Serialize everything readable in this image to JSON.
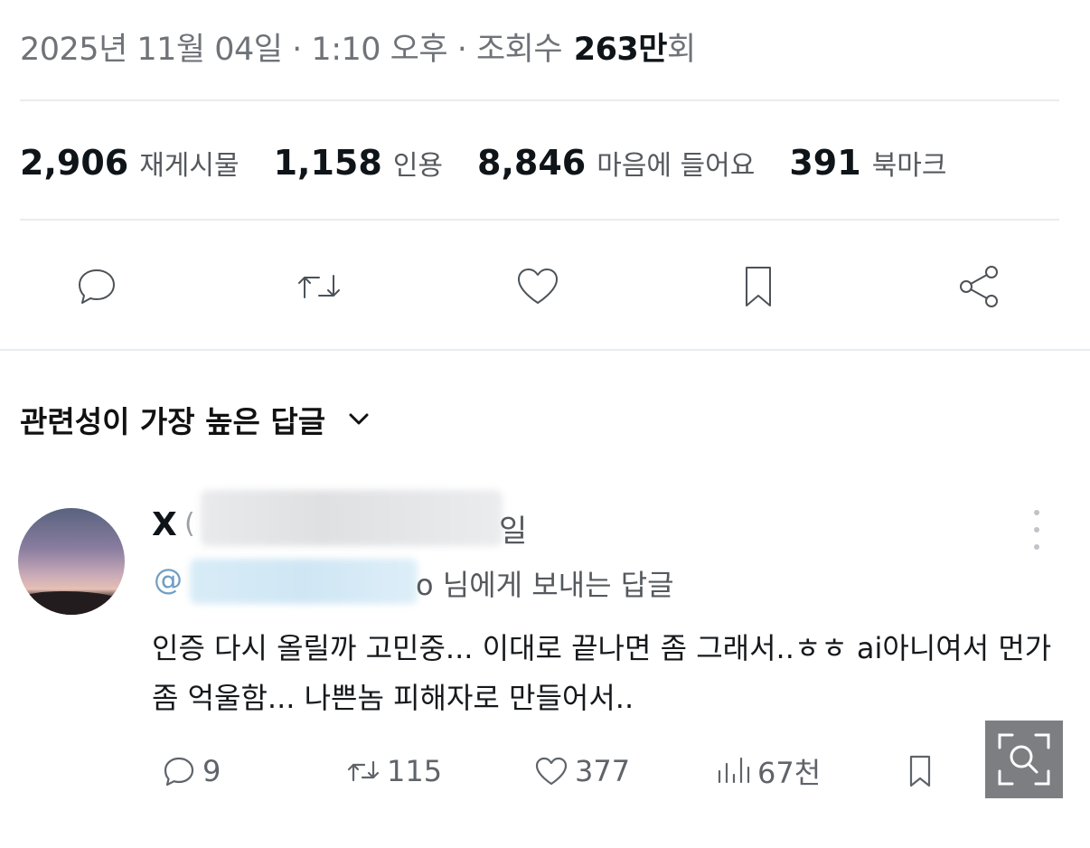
{
  "post_meta": {
    "date": "2025년 11월 04일",
    "sep1": "·",
    "time": "1:10 오후",
    "sep2": "·",
    "views_label": "조회수",
    "views_value": "263만",
    "views_suffix": "회"
  },
  "stats": [
    {
      "value": "2,906",
      "label": "재게시물"
    },
    {
      "value": "1,158",
      "label": "인용"
    },
    {
      "value": "8,846",
      "label": "마음에 들어요"
    },
    {
      "value": "391",
      "label": "북마크"
    }
  ],
  "action_icons": [
    "reply-icon",
    "repost-icon",
    "like-icon",
    "bookmark-icon",
    "share-icon"
  ],
  "replies_sort": {
    "label": "관련성이 가장 높은 답글"
  },
  "reply": {
    "display_name": "X",
    "handle_open": "(",
    "time_suffix": "일",
    "reply_to_at": "@",
    "reply_to_tail": "o 님에게 보내는 답글",
    "text": "인증 다시 올릴까 고민중... 이대로 끝나면 좀 그래서..ㅎㅎ ai아니여서 먼가 좀 억울함... 나쁜놈 피해자로 만들어서..",
    "counts": {
      "replies": "9",
      "reposts": "115",
      "likes": "377",
      "views": "67천"
    }
  },
  "colors": {
    "text": "#0f1419",
    "muted": "#6f7378",
    "divider": "#e9ecef",
    "link": "#6f9ec4"
  }
}
